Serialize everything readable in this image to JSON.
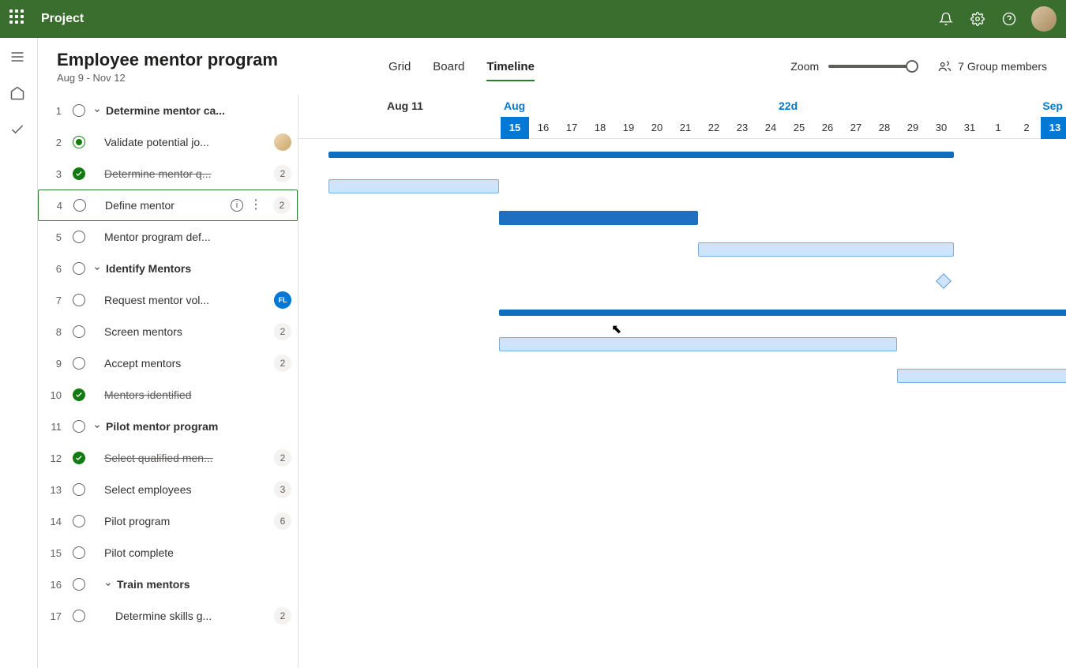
{
  "topbar": {
    "app_name": "Project"
  },
  "header": {
    "title": "Employee mentor program",
    "dates": "Aug 9 - Nov 12",
    "tabs": {
      "grid": "Grid",
      "board": "Board",
      "timeline": "Timeline"
    },
    "zoom_label": "Zoom",
    "members_label": "7 Group members"
  },
  "timeline": {
    "label_aug11": "Aug 11",
    "label_aug": "Aug",
    "label_22d": "22d",
    "label_sep": "Sep",
    "days": [
      "15",
      "16",
      "17",
      "18",
      "19",
      "20",
      "21",
      "22",
      "23",
      "24",
      "25",
      "26",
      "27",
      "28",
      "29",
      "30",
      "31",
      "1",
      "2",
      "13"
    ]
  },
  "tasks": [
    {
      "n": "1",
      "name": "Determine mentor ca...",
      "bold": true,
      "chev": true,
      "status": "open"
    },
    {
      "n": "2",
      "name": "Validate potential jo...",
      "indent": 1,
      "status": "progress",
      "avatar": true
    },
    {
      "n": "3",
      "name": "Determine mentor q...",
      "indent": 1,
      "status": "done",
      "strike": true,
      "badge": "2"
    },
    {
      "n": "4",
      "name": "Define mentor",
      "indent": 1,
      "status": "open",
      "badge": "2",
      "info": true,
      "dots": true,
      "selected": true
    },
    {
      "n": "5",
      "name": "Mentor program def...",
      "indent": 1,
      "status": "open"
    },
    {
      "n": "6",
      "name": "Identify Mentors",
      "bold": true,
      "chev": true,
      "status": "open"
    },
    {
      "n": "7",
      "name": "Request mentor vol...",
      "indent": 1,
      "status": "open",
      "blue": "FL"
    },
    {
      "n": "8",
      "name": "Screen mentors",
      "indent": 1,
      "status": "open",
      "badge": "2"
    },
    {
      "n": "9",
      "name": "Accept mentors",
      "indent": 1,
      "status": "open",
      "badge": "2"
    },
    {
      "n": "10",
      "name": "Mentors identified",
      "indent": 1,
      "status": "done",
      "strike": true
    },
    {
      "n": "11",
      "name": "Pilot mentor program",
      "bold": true,
      "chev": true,
      "status": "open"
    },
    {
      "n": "12",
      "name": "Select qualified men...",
      "indent": 1,
      "status": "done",
      "strike": true,
      "badge": "2"
    },
    {
      "n": "13",
      "name": "Select employees",
      "indent": 1,
      "status": "open",
      "badge": "3"
    },
    {
      "n": "14",
      "name": "Pilot program",
      "indent": 1,
      "status": "open",
      "badge": "6"
    },
    {
      "n": "15",
      "name": "Pilot complete",
      "indent": 1,
      "status": "open"
    },
    {
      "n": "16",
      "name": "Train mentors",
      "bold": true,
      "chev": true,
      "chev_indent": true,
      "status": "open"
    },
    {
      "n": "17",
      "name": "Determine skills g...",
      "indent": 2,
      "status": "open",
      "badge": "2"
    }
  ]
}
